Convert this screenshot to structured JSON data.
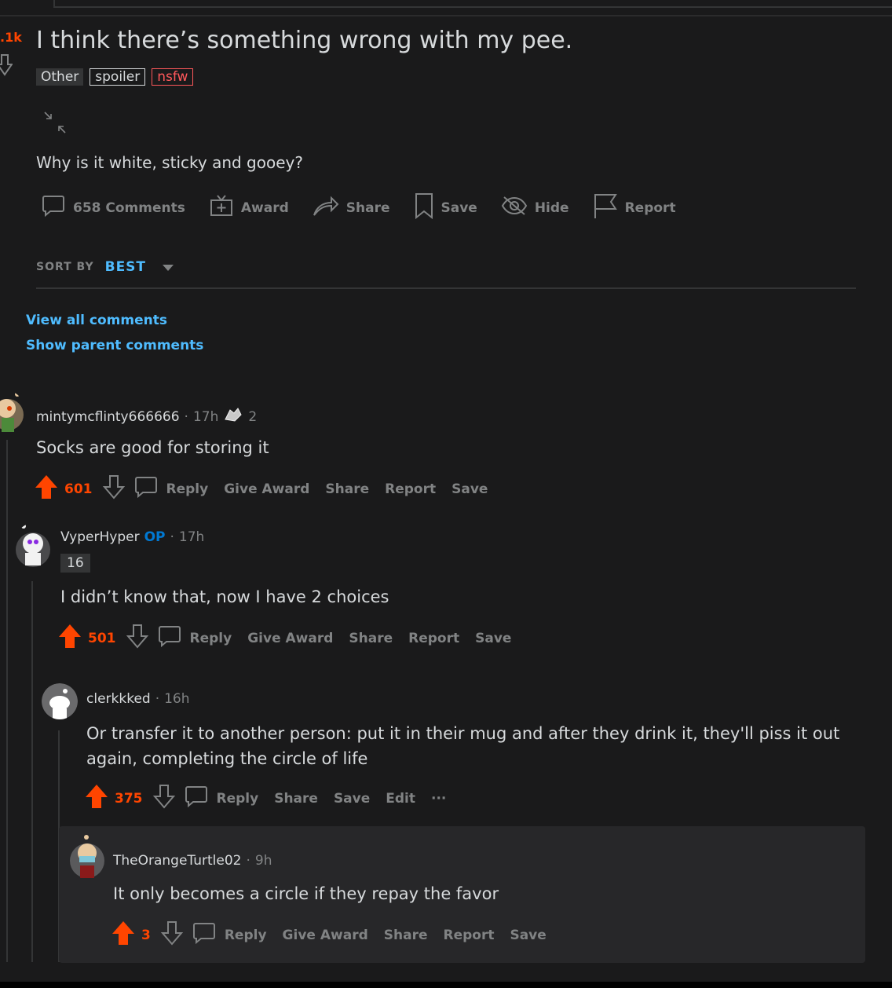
{
  "post": {
    "vote_count": ".1k",
    "title": "I think there’s something wrong with my pee.",
    "flairs": [
      "Other",
      "spoiler",
      "nsfw"
    ],
    "body": "Why is it white, sticky and gooey?",
    "actions": {
      "comments": "658 Comments",
      "award": "Award",
      "share": "Share",
      "save": "Save",
      "hide": "Hide",
      "report": "Report"
    }
  },
  "sort": {
    "label": "SORT BY",
    "value": "BEST"
  },
  "links": {
    "view_all": "View all comments",
    "show_parent": "Show parent comments"
  },
  "comments": [
    {
      "author": "mintymcflinty666666",
      "time": "17h",
      "awards": "2",
      "text": "Socks are good for storing it",
      "score": "601",
      "actions": [
        "Reply",
        "Give Award",
        "Share",
        "Report",
        "Save"
      ]
    },
    {
      "author": "VyperHyper",
      "op": "OP",
      "time": "17h",
      "badge": "16",
      "text": "I didn’t know that, now I have 2 choices",
      "score": "501",
      "actions": [
        "Reply",
        "Give Award",
        "Share",
        "Report",
        "Save"
      ]
    },
    {
      "author": "clerkkked",
      "time": "16h",
      "text": "Or transfer it to another person: put it in their mug and after they drink it, they'll piss it out again, completing the circle of life",
      "score": "375",
      "actions": [
        "Reply",
        "Share",
        "Save",
        "Edit",
        "···"
      ]
    },
    {
      "author": "TheOrangeTurtle02",
      "time": "9h",
      "text": "It only becomes a circle if they repay the favor",
      "score": "3",
      "actions": [
        "Reply",
        "Give Award",
        "Share",
        "Report",
        "Save"
      ]
    }
  ],
  "colors": {
    "upvote": "#ff4500",
    "link": "#4fbcff",
    "op": "#0079d3",
    "nsfw": "#ff585b"
  }
}
